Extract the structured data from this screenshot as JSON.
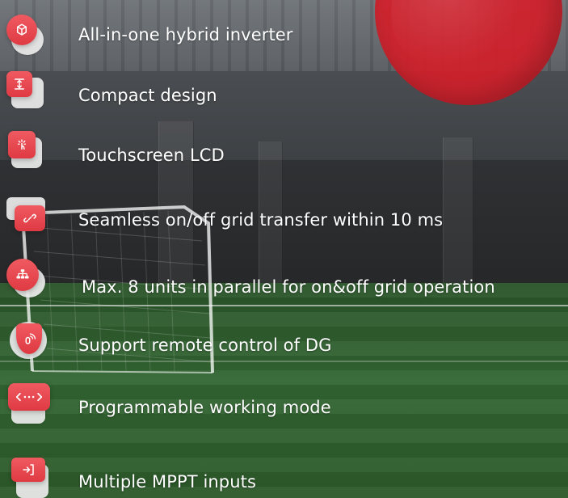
{
  "features": [
    {
      "label": "All-in-one hybrid inverter",
      "icon": "cube-icon"
    },
    {
      "label": "Compact design",
      "icon": "compress-icon"
    },
    {
      "label": "Touchscreen LCD",
      "icon": "touch-icon"
    },
    {
      "label": "Seamless on/off grid transfer within 10 ms",
      "icon": "link-icon"
    },
    {
      "label": "Max. 8 units in parallel for on&off grid operation",
      "icon": "hierarchy-icon"
    },
    {
      "label": "Support remote control of DG",
      "icon": "remote-icon"
    },
    {
      "label": "Programmable working mode",
      "icon": "code-icon"
    },
    {
      "label": "Multiple MPPT inputs",
      "icon": "input-icon"
    }
  ],
  "colors": {
    "accent": "#d3202a",
    "icon_red": "#e3434b",
    "text": "#ffffff"
  }
}
